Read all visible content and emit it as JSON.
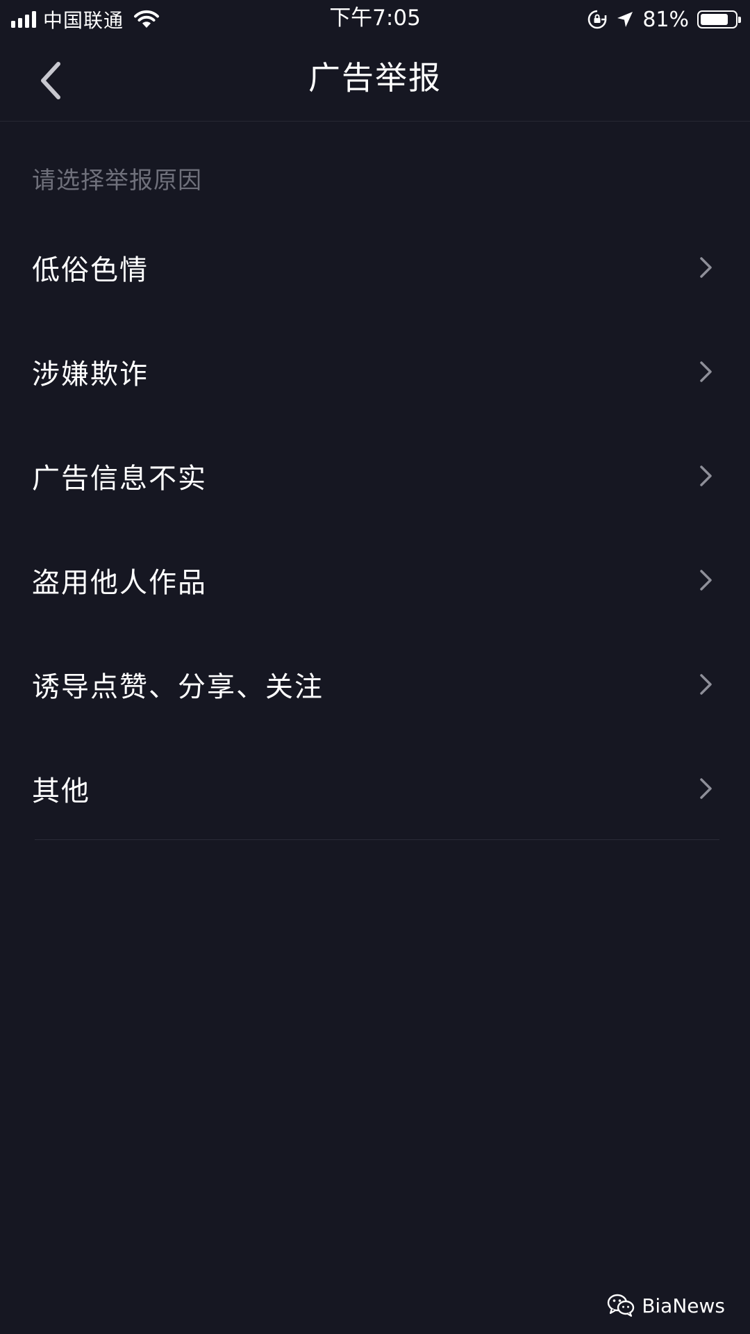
{
  "status_bar": {
    "carrier": "中国联通",
    "time": "下午7:05",
    "battery_percent": "81%",
    "battery_level": 0.81,
    "icons": [
      "signal-icon",
      "wifi-icon",
      "rotation-lock-icon",
      "location-icon",
      "battery-icon"
    ]
  },
  "nav": {
    "title": "广告举报",
    "back_icon": "chevron-left-icon"
  },
  "hint": "请选择举报原因",
  "reasons": [
    {
      "label": "低俗色情"
    },
    {
      "label": "涉嫌欺诈"
    },
    {
      "label": "广告信息不实"
    },
    {
      "label": "盗用他人作品"
    },
    {
      "label": "诱导点赞、分享、关注"
    },
    {
      "label": "其他"
    }
  ],
  "watermark": {
    "text": "BiaNews",
    "icon": "wechat-icon"
  },
  "colors": {
    "background": "#161722",
    "text_primary": "#ffffff",
    "text_secondary": "#6f707b",
    "chevron": "#8e8f99",
    "divider": "#2a2b37"
  }
}
